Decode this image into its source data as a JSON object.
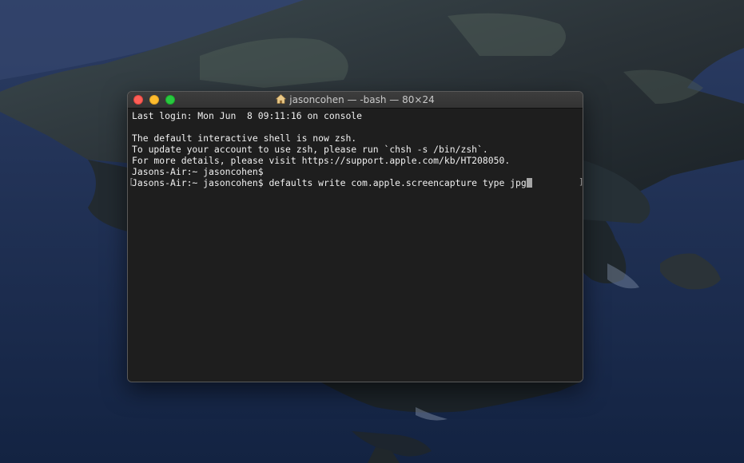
{
  "window": {
    "title": "jasoncohen — -bash — 80×24",
    "title_icon": "home-icon"
  },
  "terminal": {
    "lines": [
      "Last login: Mon Jun  8 09:11:16 on console",
      "",
      "The default interactive shell is now zsh.",
      "To update your account to use zsh, please run `chsh -s /bin/zsh`.",
      "For more details, please visit https://support.apple.com/kb/HT208050.",
      "Jasons-Air:~ jasoncohen$",
      "Jasons-Air:~ jasoncohen$ defaults write com.apple.screencapture type jpg"
    ]
  },
  "colors": {
    "close": "#fe5f57",
    "minimize": "#febc2e",
    "maximize": "#28c840",
    "terminal_bg": "#1e1e1e",
    "text": "#f0f0f0"
  }
}
